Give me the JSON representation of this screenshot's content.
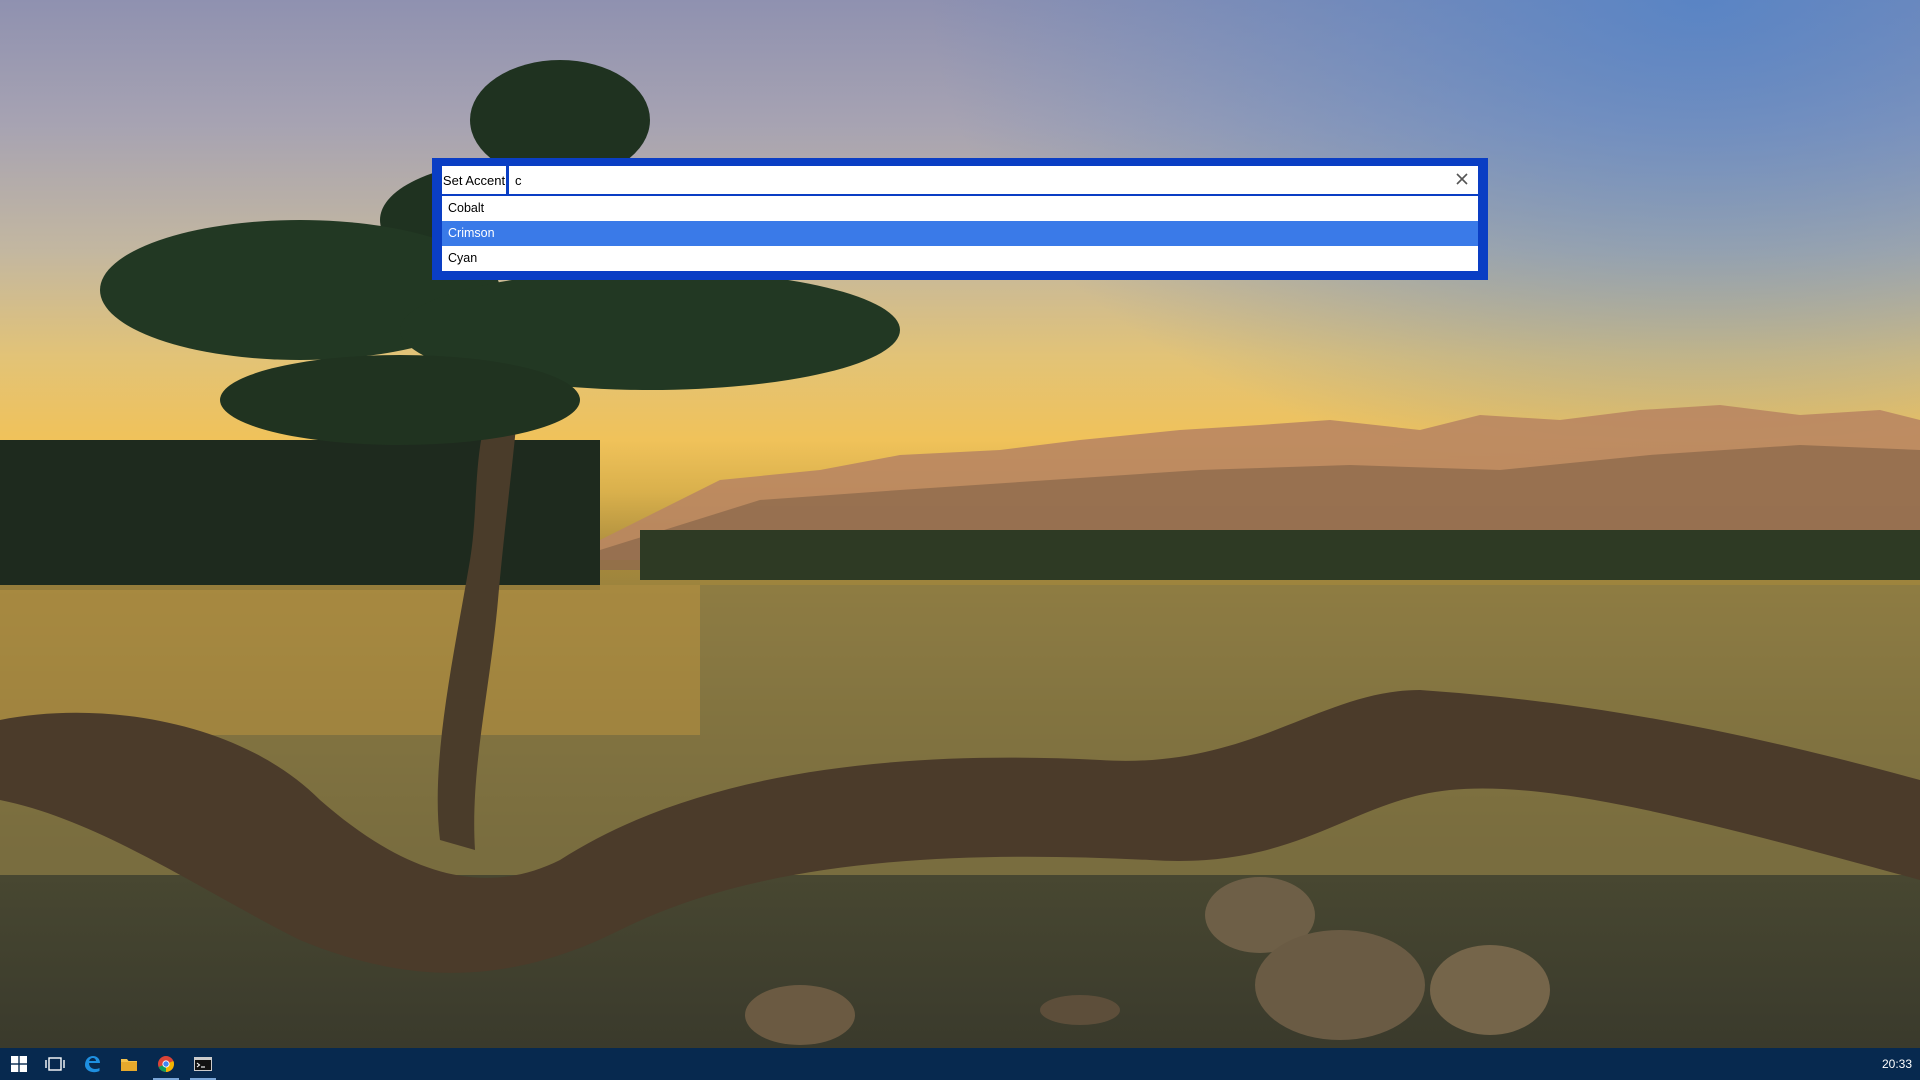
{
  "launcher": {
    "command_label": "Set Accent",
    "query": "c",
    "clear_icon": "close-icon",
    "results": [
      {
        "label": "Cobalt",
        "selected": false
      },
      {
        "label": "Crimson",
        "selected": true
      },
      {
        "label": "Cyan",
        "selected": false
      }
    ],
    "accent_color": "#0a3ec4",
    "selection_color": "#3a7ae8"
  },
  "taskbar": {
    "items": [
      {
        "icon": "windows-start-icon"
      },
      {
        "icon": "task-view-icon"
      },
      {
        "icon": "edge-browser-icon"
      },
      {
        "icon": "file-explorer-icon"
      },
      {
        "icon": "chrome-icon"
      },
      {
        "icon": "command-prompt-icon"
      }
    ],
    "clock": "20:33",
    "background_color": "#07294f"
  }
}
